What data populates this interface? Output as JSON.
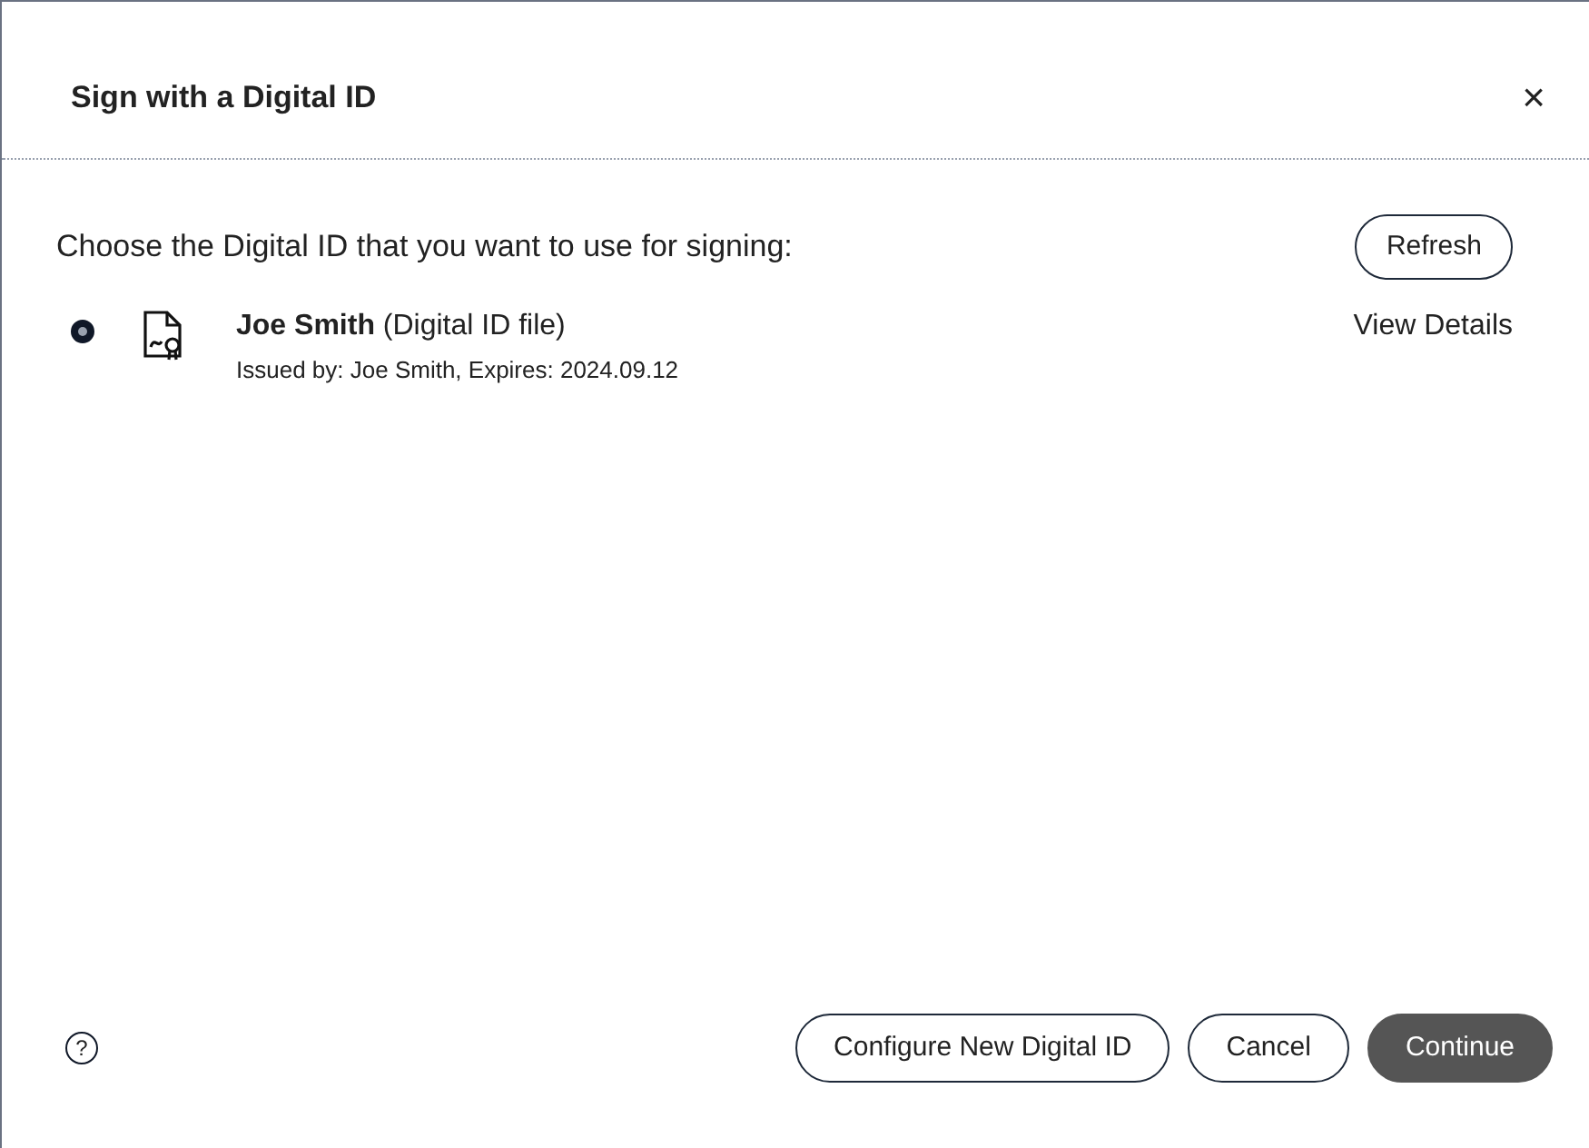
{
  "dialog": {
    "title": "Sign with a Digital ID",
    "close": "×"
  },
  "instruction": "Choose the Digital ID that you want to use for signing:",
  "refresh": "Refresh",
  "ids": [
    {
      "name": "**Joe Smith** (Digital ID file)",
      "details": "Issued by: Joe Smith, Expires: 2024.09.12",
      "selected": true,
      "link": "View Details"
    }
  ],
  "help": "?",
  "buttons": [
    {
      "label": "Configure New Digital ID",
      "kind": "secondary"
    },
    {
      "label": "Cancel",
      "kind": "secondary"
    },
    {
      "label": "Continue",
      "kind": "primary"
    }
  ]
}
